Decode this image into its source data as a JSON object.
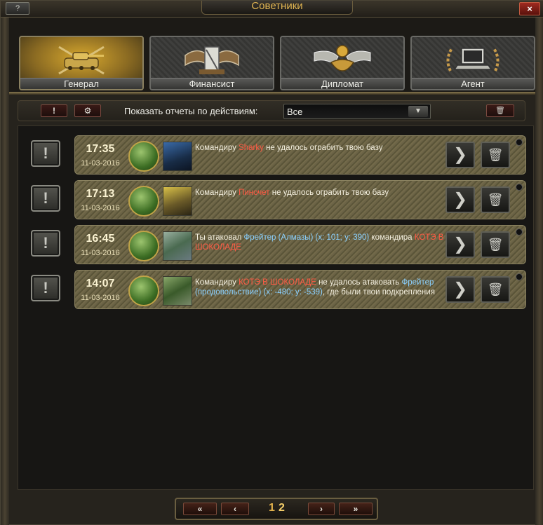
{
  "window": {
    "title": "Советники",
    "help_label": "?",
    "close_label": "×"
  },
  "tabs": [
    {
      "label": "Генерал",
      "icon": "tank-emblem-icon",
      "active": true
    },
    {
      "label": "Финансист",
      "icon": "money-emblem-icon",
      "active": false
    },
    {
      "label": "Дипломат",
      "icon": "handshake-emblem-icon",
      "active": false
    },
    {
      "label": "Агент",
      "icon": "laptop-emblem-icon",
      "active": false
    }
  ],
  "filter": {
    "alert_button_label": "!",
    "settings_button_label": "⚙",
    "label": "Показать отчеты по действиям:",
    "selected": "Все",
    "delete_all_label": "🗑"
  },
  "reports": [
    {
      "time": "17:35",
      "date": "11-03-2016",
      "icon": "pistol-medal-icon",
      "avatar": "soldier-avatar",
      "parts": [
        {
          "text": "Командиру ",
          "style": "plain"
        },
        {
          "text": "Sharky",
          "style": "red"
        },
        {
          "text": " не удалось ограбить твою базу",
          "style": "plain"
        }
      ]
    },
    {
      "time": "17:13",
      "date": "11-03-2016",
      "icon": "pistol-medal-icon",
      "avatar": "sniper-avatar",
      "parts": [
        {
          "text": "Командиру ",
          "style": "plain"
        },
        {
          "text": "Пиночет",
          "style": "red"
        },
        {
          "text": " не удалось ограбить твою базу",
          "style": "plain"
        }
      ]
    },
    {
      "time": "16:45",
      "date": "11-03-2016",
      "icon": "supply-medal-icon",
      "avatar": "base-avatar",
      "parts": [
        {
          "text": "Ты атаковал ",
          "style": "plain"
        },
        {
          "text": "Фрейтер (Алмазы) (x: 101; y: 390)",
          "style": "blue"
        },
        {
          "text": " командира ",
          "style": "plain"
        },
        {
          "text": "КОТЭ В ШОКОЛАДЕ",
          "style": "red"
        }
      ]
    },
    {
      "time": "14:07",
      "date": "11-03-2016",
      "icon": "supply-medal-icon",
      "avatar": "forest-base-avatar",
      "parts": [
        {
          "text": "Командиру ",
          "style": "plain"
        },
        {
          "text": "КОТЭ В ШОКОЛАДЕ",
          "style": "red"
        },
        {
          "text": " не удалось атаковать ",
          "style": "plain"
        },
        {
          "text": "Фрейтер (продовольствие) (x: -480; y: -539)",
          "style": "blue"
        },
        {
          "text": ", где были твои подкрепления",
          "style": "plain"
        }
      ]
    }
  ],
  "report_actions": {
    "open_label": "❯",
    "delete_label": "🗑",
    "flag_label": "!"
  },
  "pagination": {
    "first_label": "«",
    "prev_label": "‹",
    "pages": [
      "1",
      "2"
    ],
    "current_page": "2",
    "next_label": "›",
    "last_label": "»"
  },
  "colors": {
    "title": "#e0b451",
    "player_name": "#ff5a44",
    "location_link": "#8ad0ff",
    "active_tab": "#d7a82e"
  }
}
